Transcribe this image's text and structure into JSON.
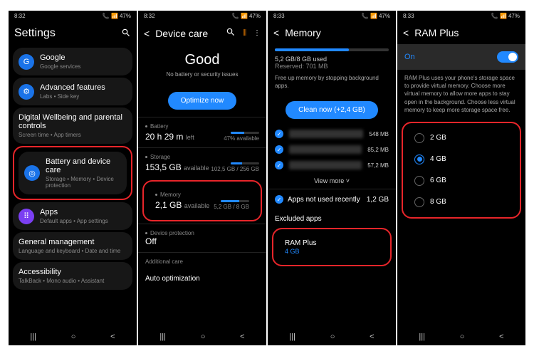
{
  "status": {
    "time": "8:32",
    "time2": "8:32",
    "time3": "8:33",
    "time4": "8:33",
    "battery": "47%",
    "signal": "📶"
  },
  "p1": {
    "title": "Settings",
    "items": [
      {
        "title": "Google",
        "sub": "Google services"
      },
      {
        "title": "Advanced features",
        "sub": "Labs • Side key"
      },
      {
        "title": "Digital Wellbeing and parental controls",
        "sub": "Screen time • App timers"
      },
      {
        "title": "Battery and device care",
        "sub": "Storage • Memory • Device protection"
      },
      {
        "title": "Apps",
        "sub": "Default apps • App settings"
      },
      {
        "title": "General management",
        "sub": "Language and keyboard • Date and time"
      },
      {
        "title": "Accessibility",
        "sub": "TalkBack • Mono audio • Assistant"
      }
    ]
  },
  "p2": {
    "title": "Device care",
    "status": "Good",
    "statusSub": "No battery or security issues",
    "btn": "Optimize now",
    "battery": {
      "label": "Battery",
      "main": "20 h 29 m",
      "mainSuffix": "left",
      "right": "47% available",
      "fill": 47
    },
    "storage": {
      "label": "Storage",
      "main": "153,5 GB",
      "mainSuffix": "available",
      "right": "102,5 GB / 256 GB",
      "fill": 40
    },
    "memory": {
      "label": "Memory",
      "main": "2,1 GB",
      "mainSuffix": "available",
      "right": "5,2 GB / 8 GB",
      "fill": 65
    },
    "protection": {
      "label": "Device protection",
      "main": "Off"
    },
    "additional": "Additional care",
    "auto": "Auto optimization"
  },
  "p3": {
    "title": "Memory",
    "usage": "5,2 GB/8 GB used",
    "reserved": "Reserved: 701 MB",
    "desc": "Free up memory by stopping background apps.",
    "btn": "Clean now (+2,4 GB)",
    "apps": [
      {
        "size": "548 MB"
      },
      {
        "size": "85,2 MB"
      },
      {
        "size": "57,2 MB"
      }
    ],
    "viewMore": "View more",
    "notUsed": {
      "label": "Apps not used recently",
      "val": "1,2 GB"
    },
    "excluded": "Excluded apps",
    "ramplus": {
      "label": "RAM Plus",
      "val": "4 GB"
    },
    "barFill": 65
  },
  "p4": {
    "title": "RAM Plus",
    "toggle": "On",
    "desc": "RAM Plus uses your phone's storage space to provide virtual memory. Choose more virtual memory to allow more apps to stay open in the background. Choose less virtual memory to keep more storage space free.",
    "options": [
      "2 GB",
      "4 GB",
      "6 GB",
      "8 GB"
    ],
    "selected": 1
  }
}
